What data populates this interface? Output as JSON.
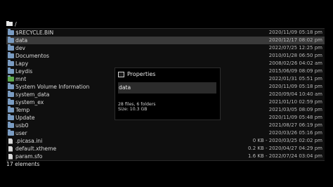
{
  "path": "/",
  "files": [
    {
      "name": "$RECYCLE.BIN",
      "meta": "2020/11/09 05:18 pm",
      "type": "folder"
    },
    {
      "name": "data",
      "meta": "2020/12/17 08:02 pm",
      "type": "folder"
    },
    {
      "name": "dev",
      "meta": "2022/07/25 12:25 pm",
      "type": "folder"
    },
    {
      "name": "Documentos",
      "meta": "2010/01/28 06:50 pm",
      "type": "folder"
    },
    {
      "name": "Lapy",
      "meta": "2008/02/26 04:02 am",
      "type": "folder"
    },
    {
      "name": "Leydis",
      "meta": "2015/06/09 08:09 pm",
      "type": "folder"
    },
    {
      "name": "mnt",
      "meta": "2022/01/31 05:51 pm",
      "type": "folder-green"
    },
    {
      "name": "System Volume Information",
      "meta": "2020/11/09 05:18 pm",
      "type": "folder"
    },
    {
      "name": "system_data",
      "meta": "2020/09/04 10:40 am",
      "type": "folder"
    },
    {
      "name": "system_ex",
      "meta": "2021/01/10 02:59 pm",
      "type": "folder"
    },
    {
      "name": "Temp",
      "meta": "2021/03/05 08:09 pm",
      "type": "folder"
    },
    {
      "name": "Update",
      "meta": "2020/11/09 05:48 pm",
      "type": "folder"
    },
    {
      "name": "usb0",
      "meta": "2021/08/27 06:19 pm",
      "type": "folder"
    },
    {
      "name": "user",
      "meta": "2020/03/26 05:16 pm",
      "type": "folder"
    },
    {
      "name": ".picasa.ini",
      "meta": "0 KB - 2020/03/25 02:02 pm",
      "type": "file"
    },
    {
      "name": "default.xtheme",
      "meta": "0.2 KB - 2020/04/27 04:29 pm",
      "type": "file"
    },
    {
      "name": "param.sfo",
      "meta": "1.6 KB - 2022/07/24 03:04 pm",
      "type": "file"
    }
  ],
  "selected_index": 1,
  "status": "17 elements",
  "properties": {
    "title": "Properties",
    "name": "data",
    "summary": "28 files, 6 folders",
    "size": "Size: 10.3 GB"
  },
  "colors": {
    "folder": "#7a9cc2",
    "folder_green": "#5ea94e",
    "selected_row": "#3a3a3a"
  }
}
